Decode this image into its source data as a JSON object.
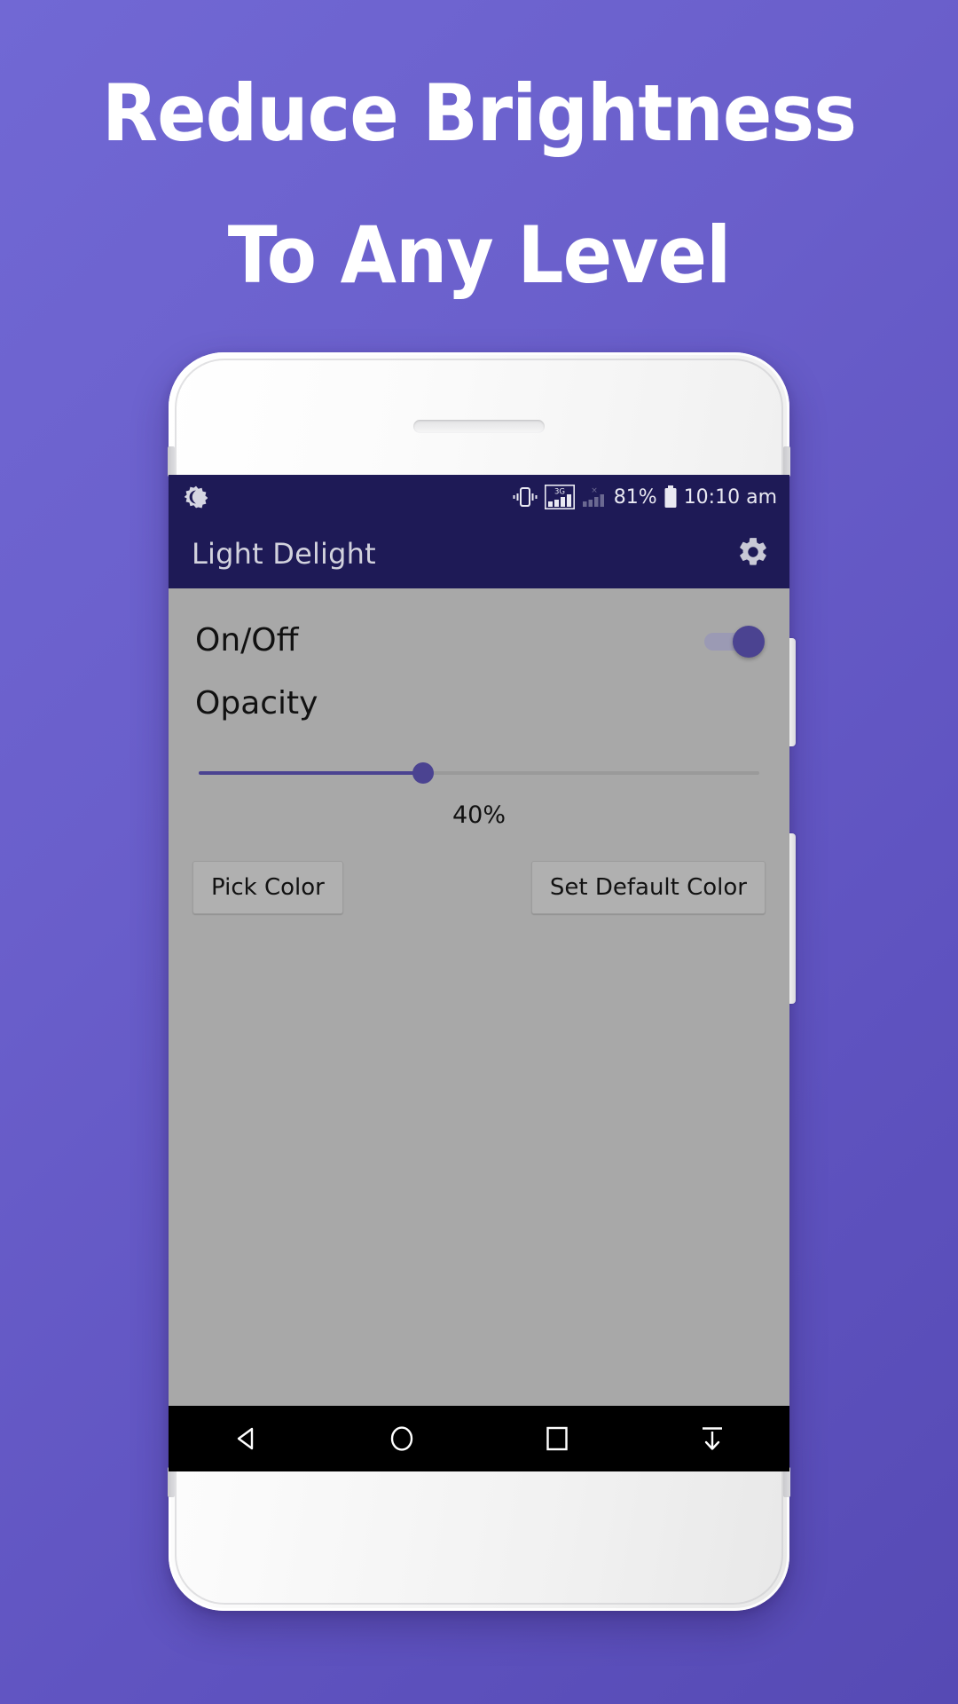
{
  "promo": {
    "headline_lines": [
      "Reduce Brightness",
      "To Any Level"
    ],
    "background_color_start": "#7168d4",
    "background_color_end": "#564ab4",
    "headline_color": "#ffffff"
  },
  "phone": {
    "frame_color": "#f4f4f4"
  },
  "status_bar": {
    "background_color": "#1e1a56",
    "notification_icon": "brightness-icon",
    "vibrate_icon": "vibrate-icon",
    "network_type": "3G",
    "signal_icon": "signal-bars-icon",
    "sim2_icon": "signal-bars-no-service-icon",
    "battery_percent": "81%",
    "battery_icon": "battery-icon",
    "clock": "10:10 am"
  },
  "app_bar": {
    "title": "Light Delight",
    "settings_icon": "gear-icon",
    "background_color": "#1e1a56",
    "title_color": "#d2d2dd"
  },
  "screen": {
    "background_color": "#a8a8a8",
    "onoff": {
      "label": "On/Off",
      "enabled": true,
      "accent_color": "#4b4391"
    },
    "opacity": {
      "label": "Opacity",
      "value_label": "40%",
      "value_percent": 40,
      "accent_color": "#4b4391",
      "track_color": "#9a9a9a"
    },
    "buttons": [
      {
        "label": "Pick Color",
        "name": "pick-color-button"
      },
      {
        "label": "Set Default Color",
        "name": "set-default-color-button"
      }
    ]
  },
  "nav_bar": {
    "background_color": "#000000",
    "items": [
      {
        "name": "nav-back-icon",
        "label": "Back"
      },
      {
        "name": "nav-home-icon",
        "label": "Home"
      },
      {
        "name": "nav-recents-icon",
        "label": "Recent apps"
      },
      {
        "name": "nav-hide-icon",
        "label": "Hide navigation bar"
      }
    ]
  }
}
